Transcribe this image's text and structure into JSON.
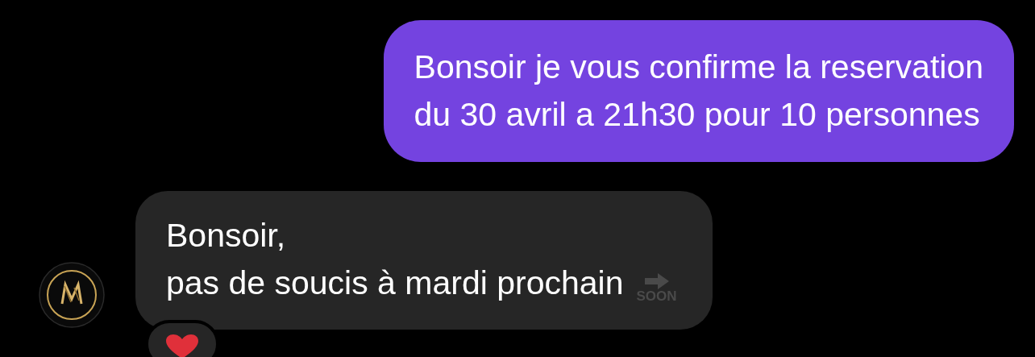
{
  "messages": [
    {
      "kind": "sent",
      "lines": [
        "Bonsoir je vous confirme la reservation",
        "du 30 avril a 21h30 pour 10 personnes"
      ]
    },
    {
      "kind": "received",
      "lines": [
        "Bonsoir,",
        "pas de soucis à mardi prochain"
      ],
      "emoji_label": "SOON",
      "reaction": {
        "kind": "heart"
      }
    }
  ]
}
